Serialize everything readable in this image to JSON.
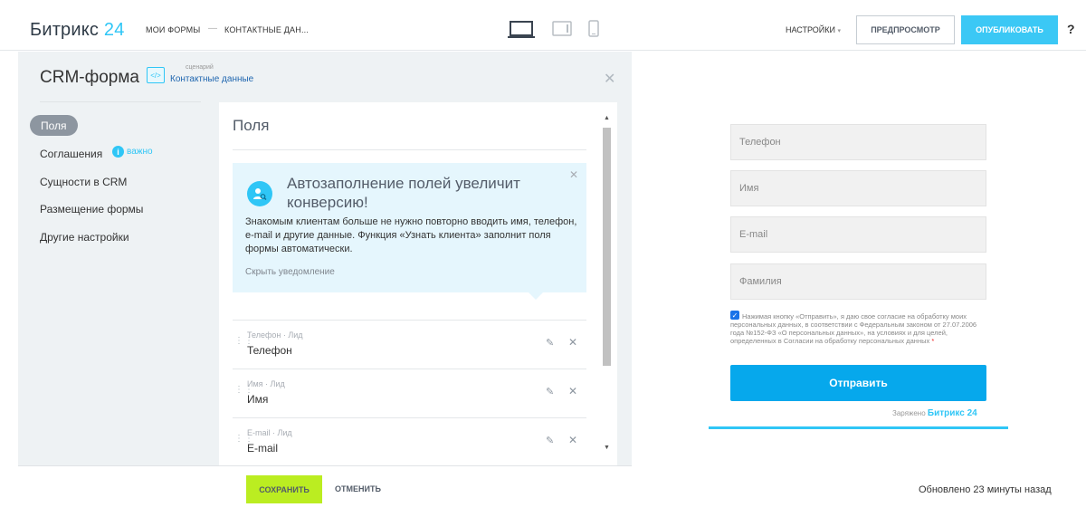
{
  "header": {
    "logo_text": "Битрикс",
    "logo_num": "24",
    "crumb1": "МОИ ФОРМЫ",
    "crumb_sep": "—",
    "crumb2": "КОНТАКТНЫЕ ДАН...",
    "settings": "НАСТРОЙКИ",
    "preview": "ПРЕДПРОСМОТР",
    "publish": "ОПУБЛИКОВАТЬ",
    "help": "?"
  },
  "panel": {
    "title": "CRM-форма",
    "scenario_small": "сценарий",
    "scenario_link": "Контактные данные",
    "nav": [
      {
        "label": "Поля"
      },
      {
        "label": "Соглашения",
        "badge": "важно"
      },
      {
        "label": "Сущности в CRM"
      },
      {
        "label": "Размещение формы"
      },
      {
        "label": "Другие настройки"
      }
    ],
    "card_title": "Поля",
    "notice": {
      "title": "Автозаполнение полей увеличит конверсию!",
      "text": "Знакомым клиентам больше не нужно повторно вводить имя, телефон, e-mail и другие данные. Функция «Узнать клиента» заполнит поля формы автоматически.",
      "hide": "Скрыть уведомление"
    },
    "fields": [
      {
        "meta": "Телефон · Лид",
        "name": "Телефон"
      },
      {
        "meta": "Имя · Лид",
        "name": "Имя"
      },
      {
        "meta": "E-mail · Лид",
        "name": "E-mail"
      }
    ]
  },
  "footer": {
    "save": "СОХРАНИТЬ",
    "cancel": "ОТМЕНИТЬ"
  },
  "preview_form": {
    "placeholders": [
      "Телефон",
      "Имя",
      "E-mail",
      "Фамилия"
    ],
    "consent": "Нажимая кнопку «Отправить», я даю свое согласие на обработку моих персональных данных, в соответствии с Федеральным законом от 27.07.2006 года №152-ФЗ «О персональных данных», на условиях и для целей, определенных в Согласии на обработку персональных данных",
    "submit": "Отправить",
    "powered_prefix": "Заряжено",
    "powered_brand": "Битрикс 24",
    "updated": "Обновлено 23 минуты назад"
  },
  "colors": {
    "accent": "#2fc6f6",
    "save_button": "#bbed21",
    "submit_button": "#06a8ec"
  }
}
